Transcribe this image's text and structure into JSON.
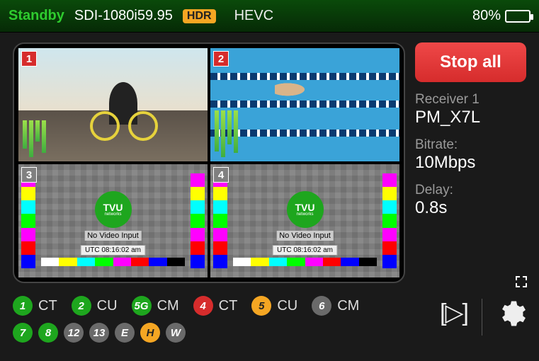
{
  "header": {
    "status": "Standby",
    "format": "SDI-1080i59.95",
    "hdr_badge": "HDR",
    "codec": "HEVC",
    "battery_pct": "80%"
  },
  "grid": {
    "cells": [
      {
        "num": "1",
        "kind": "bike"
      },
      {
        "num": "2",
        "kind": "swim"
      },
      {
        "num": "3",
        "kind": "testcard",
        "logo": "TVU",
        "logo_sub": "networks",
        "msg": "No Video Input",
        "utc": "UTC 08:16:02 am"
      },
      {
        "num": "4",
        "kind": "testcard",
        "logo": "TVU",
        "logo_sub": "networks",
        "msg": "No Video Input",
        "utc": "UTC 08:16:02 am"
      }
    ]
  },
  "side": {
    "stop_label": "Stop all",
    "receiver_lbl": "Receiver 1",
    "receiver_val": "PM_X7L",
    "bitrate_lbl": "Bitrate:",
    "bitrate_val": "10Mbps",
    "delay_lbl": "Delay:",
    "delay_val": "0.8s"
  },
  "indicators": {
    "row1": [
      {
        "num": "1",
        "color": "green",
        "label": "CT"
      },
      {
        "num": "2",
        "color": "green",
        "label": "CU"
      },
      {
        "num": "5G",
        "color": "green",
        "label": "CM"
      },
      {
        "num": "4",
        "color": "red",
        "label": "CT"
      },
      {
        "num": "5",
        "color": "orange",
        "label": "CU"
      },
      {
        "num": "6",
        "color": "gray",
        "label": "CM"
      }
    ],
    "row2": [
      {
        "num": "7",
        "color": "green"
      },
      {
        "num": "8",
        "color": "green"
      },
      {
        "num": "12",
        "color": "gray"
      },
      {
        "num": "13",
        "color": "gray"
      },
      {
        "num": "E",
        "color": "gray"
      },
      {
        "num": "H",
        "color": "orange"
      },
      {
        "num": "W",
        "color": "gray"
      }
    ]
  },
  "icons": {
    "play_bracket": "[▷]"
  }
}
